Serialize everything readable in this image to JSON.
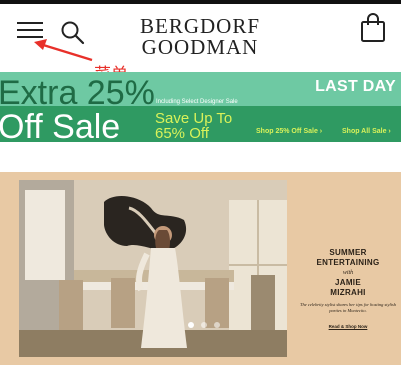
{
  "header": {
    "logo_line1": "BERGDORF",
    "logo_line2": "GOODMAN",
    "menu_icon": "hamburger-menu-icon",
    "search_icon": "search-icon",
    "bag_icon": "shopping-bag-icon"
  },
  "annotation": {
    "label": "菜单",
    "color": "#e8302a"
  },
  "promo": {
    "line1": "Extra 25%",
    "line2": "Off Sale",
    "note": "Including Select Designer Sale",
    "badge": "LAST DAY",
    "save_line1": "Save Up To",
    "save_line2": "65% Off",
    "link_extra": "Shop 25% Off Sale ›",
    "link_all": "Shop All Sale ›",
    "colors": {
      "top": "#6ec9a3",
      "bottom": "#2f9a62",
      "accent": "#d9f25a"
    }
  },
  "hero": {
    "title1": "SUMMER",
    "title2": "ENTERTAINING",
    "with": "with",
    "name1": "JAMIE",
    "name2": "MIZRAHI",
    "body": "The celebrity stylist shares her tips for hosting stylish parties in Montecito.",
    "cta": "Read & Shop Now",
    "slide_count": 3,
    "active_slide": 1,
    "background": "#e8c9a4"
  }
}
